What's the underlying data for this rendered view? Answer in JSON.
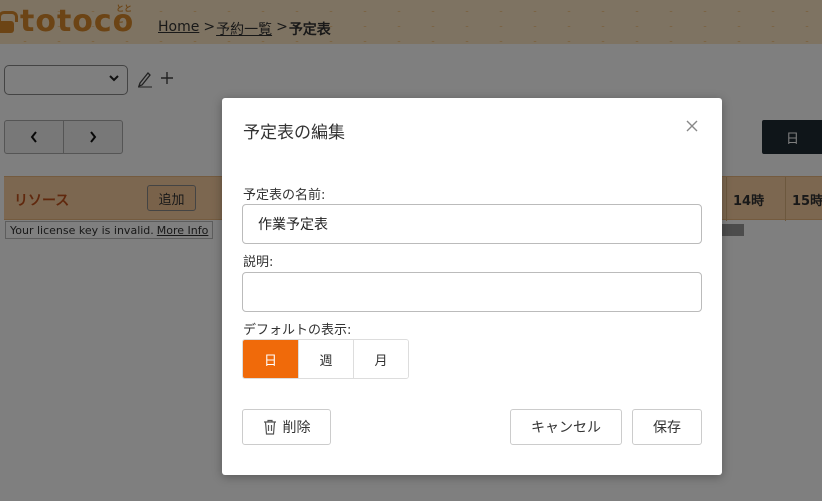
{
  "header": {
    "logo_text": "totoco",
    "logo_sub": "ととこ",
    "breadcrumb": {
      "home": "Home",
      "sep": ">",
      "list": "予約一覧",
      "current": "予定表"
    }
  },
  "toolbar": {
    "select_value": ""
  },
  "nav": {
    "prev": "‹",
    "next": "›",
    "view_day": "日"
  },
  "resource": {
    "label": "リソース",
    "add": "追加",
    "hours": [
      "14時",
      "15時"
    ]
  },
  "license": {
    "text": "Your license key is invalid.",
    "more": "More Info"
  },
  "modal": {
    "title": "予定表の編集",
    "close": "×",
    "name_label": "予定表の名前:",
    "name_value": "作業予定表",
    "desc_label": "説明:",
    "desc_value": "",
    "default_view_label": "デフォルトの表示:",
    "view_options": [
      "日",
      "週",
      "月"
    ],
    "selected_view": "日",
    "delete": "削除",
    "cancel": "キャンセル",
    "save": "保存"
  },
  "colors": {
    "accent": "#f06a0a",
    "header_bg": "#fde7c4",
    "logo": "#d9892a",
    "resource_bg": "#f9cfa0",
    "dark_button": "#1e2a33"
  }
}
